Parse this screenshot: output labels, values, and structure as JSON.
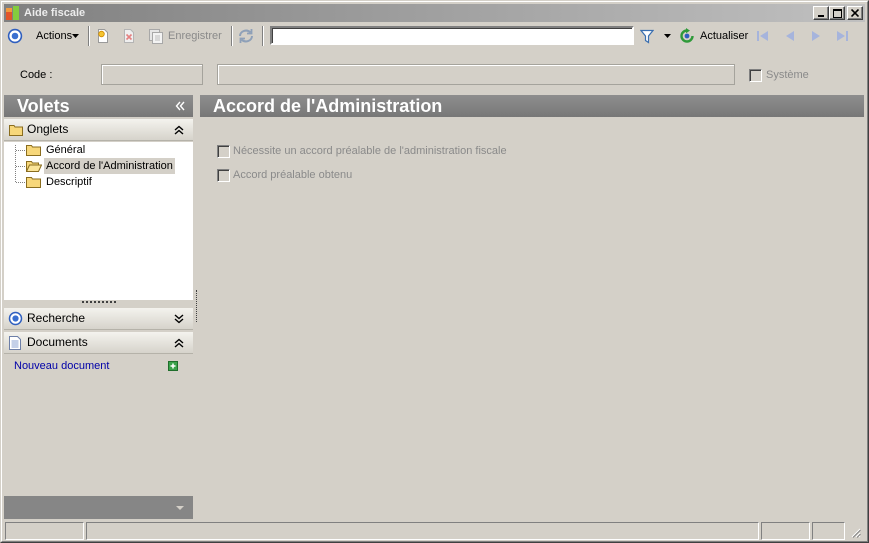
{
  "window": {
    "title": "Aide fiscale"
  },
  "toolbar": {
    "actions_label": "Actions",
    "save_label": "Enregistrer",
    "search_value": "",
    "refresh_label": "Actualiser"
  },
  "record": {
    "code_label": "Code :",
    "code_value": "",
    "description_value": "",
    "system_label": "Système",
    "system_checked": false
  },
  "sidebar": {
    "title": "Volets",
    "onglets": {
      "label": "Onglets",
      "expanded": true,
      "items": [
        {
          "label": "Général",
          "icon": "folder-icon",
          "selected": false
        },
        {
          "label": "Accord de l'Administration",
          "icon": "folder-open-icon",
          "selected": true
        },
        {
          "label": "Descriptif",
          "icon": "folder-icon",
          "selected": false
        }
      ]
    },
    "recherche": {
      "label": "Recherche",
      "expanded": false
    },
    "documents": {
      "label": "Documents",
      "expanded": true,
      "new_document_label": "Nouveau document"
    }
  },
  "main": {
    "title": "Accord de l'Administration",
    "options": [
      {
        "label": "Nécessite un accord préalable de l'administration fiscale",
        "checked": false,
        "disabled": true
      },
      {
        "label": "Accord préalable obtenu",
        "checked": false,
        "disabled": true
      }
    ]
  },
  "theme": {
    "face": "#d4d0c8",
    "header": "#808080",
    "link": "#0000a8",
    "disabled_text": "#8a8a8a"
  }
}
